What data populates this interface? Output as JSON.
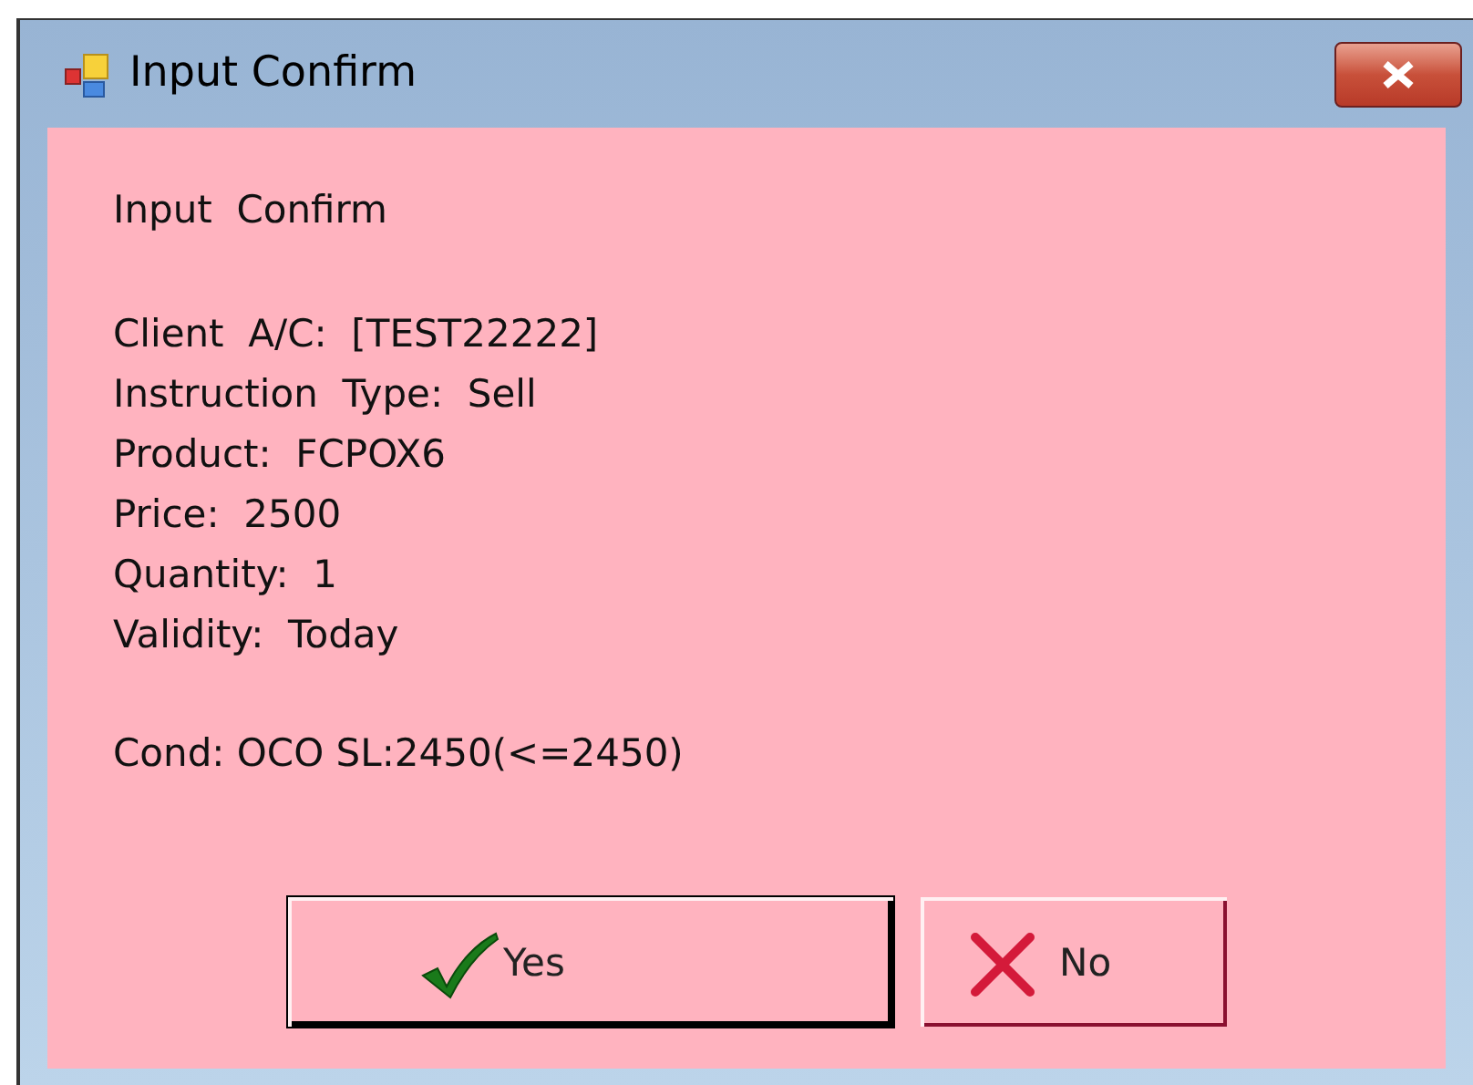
{
  "window": {
    "title": "Input Confirm"
  },
  "heading": "Input  Confirm",
  "details": [
    "Client  A/C:  [TEST22222]",
    "Instruction  Type:  Sell",
    "Product:  FCPOX6",
    "Price:  2500",
    "Quantity:  1",
    "Validity:  Today"
  ],
  "condition": "Cond: OCO SL:2450(<=2450)",
  "buttons": [
    {
      "label": "Yes",
      "kind": "yes",
      "default": true
    },
    {
      "label": "No",
      "kind": "no",
      "default": false
    }
  ]
}
